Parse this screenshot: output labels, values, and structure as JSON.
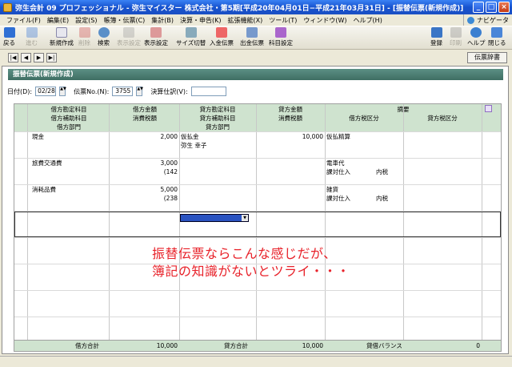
{
  "window": {
    "title": "弥生会計 09 プロフェッショナル - 弥生マイスター 株式会社・第5期[平成20年04月01日−平成21年03月31日] - [振替伝票(新規作成)]"
  },
  "menu": [
    "ファイル(F)",
    "編集(E)",
    "設定(S)",
    "帳簿・伝票(C)",
    "集計(B)",
    "決算・申告(K)",
    "拡張機能(X)",
    "ツール(T)",
    "ウィンドウ(W)",
    "ヘルプ(H)"
  ],
  "navi_label": "ナビゲータ",
  "toolbar": {
    "back": "戻る",
    "forward": "進む",
    "new": "新規作成",
    "delete": "削除",
    "search": "検索",
    "replace": "表示設定",
    "display": "表示設定",
    "size": "サイズ切替",
    "in_slip": "入金伝票",
    "out_slip": "出金伝票",
    "accounts": "科目設定",
    "register": "登録",
    "print": "印刷",
    "help": "ヘルプ",
    "close": "閉じる"
  },
  "nav": {
    "first": "|◀",
    "prev": "◀",
    "next": "▶",
    "last": "▶|",
    "dict": "伝票辞書"
  },
  "form": {
    "header": "振替伝票(新規作成)",
    "date_label": "日付(D):",
    "date_value": "02/28",
    "slip_no_label": "伝票No.(N):",
    "slip_no_value": "3755",
    "settle_label": "決算仕訳(V):",
    "settle_value": ""
  },
  "grid": {
    "headers": {
      "debit_account": "借方勘定科目",
      "debit_amount": "借方金額",
      "credit_account": "貸方勘定科目",
      "credit_amount": "貸方金額",
      "memo": "摘要",
      "debit_sub": "借方補助科目",
      "debit_tax": "消費税額",
      "credit_sub": "貸方補助科目",
      "credit_tax": "消費税額",
      "debit_taxcat": "借方税区分",
      "credit_taxcat": "貸方税区分",
      "debit_dept": "借方部門",
      "credit_dept": "貸方部門"
    },
    "rows": [
      {
        "debit_account": "現金",
        "debit_amount": "2,000",
        "credit_account": "仮払金",
        "credit_sub": "弥生 幸子",
        "credit_amount": "10,000",
        "memo": "仮払精算",
        "debit_tax": "",
        "taxcat": "",
        "taxtype": ""
      },
      {
        "debit_account": "旅費交通費",
        "debit_amount": "3,000",
        "debit_tax": "(142",
        "credit_account": "",
        "credit_amount": "",
        "memo": "電車代",
        "taxcat": "課対仕入",
        "taxtype": "内税"
      },
      {
        "debit_account": "消耗品費",
        "debit_amount": "5,000",
        "debit_tax": "(238",
        "credit_account": "",
        "credit_amount": "",
        "memo": "雑貨",
        "taxcat": "課対仕入",
        "taxtype": "内税"
      }
    ],
    "footer": {
      "debit_total_label": "借方合計",
      "debit_total": "10,000",
      "credit_total_label": "貸方合計",
      "credit_total": "10,000",
      "balance_label": "貸借バランス",
      "balance": "0"
    }
  },
  "overlay": {
    "line1": "振替伝票ならこんな感じだが、",
    "line2": "簿記の知識がないとツライ・・・"
  }
}
